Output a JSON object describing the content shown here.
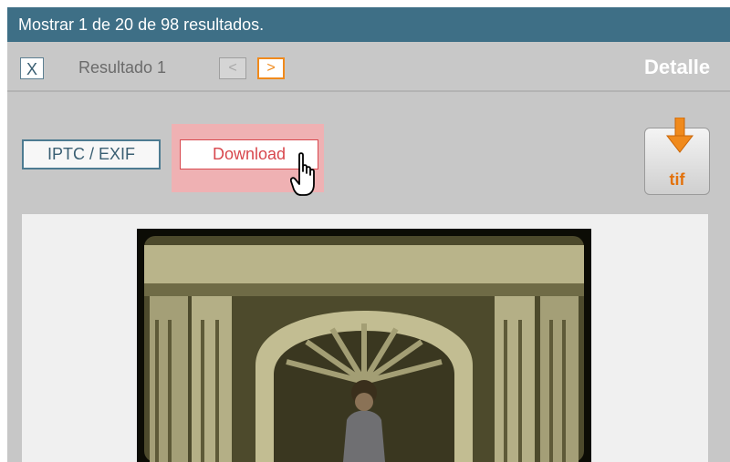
{
  "header": {
    "results_text": "Mostrar 1 de 20 de 98 resultados."
  },
  "nav": {
    "close_label": "X",
    "result_label": "Resultado 1",
    "prev_label": "<",
    "next_label": ">",
    "detail_label": "Detalle"
  },
  "actions": {
    "iptc_label": "IPTC / EXIF",
    "download_label": "Download",
    "tif_label": "tif"
  },
  "colors": {
    "header_bg": "#3e6f86",
    "accent_orange": "#f08a1c",
    "download_red": "#d8484e",
    "highlight": "#efb1b3"
  },
  "icons": {
    "tif": "download-arrow-icon",
    "cursor": "hand-pointer-icon"
  }
}
